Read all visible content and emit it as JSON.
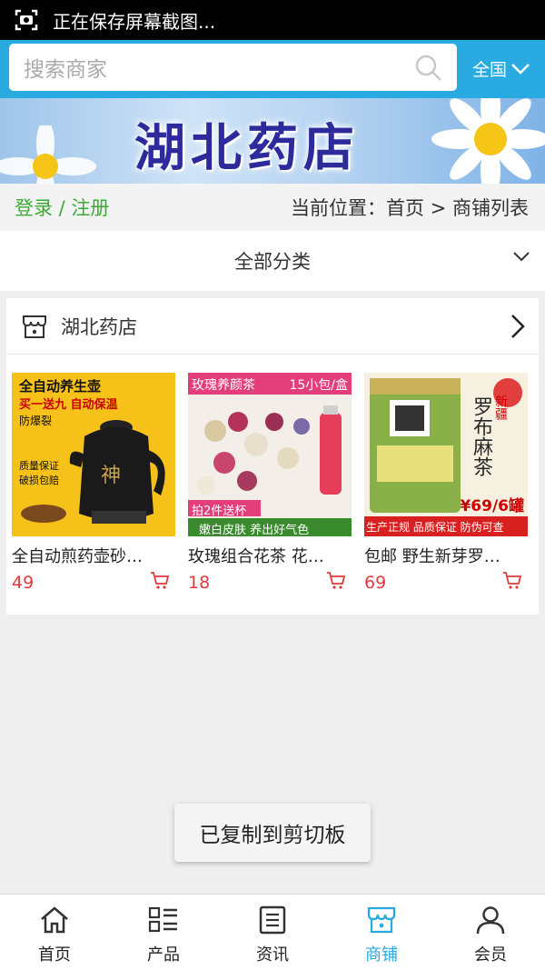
{
  "status_bar": {
    "text": "正在保存屏幕截图...",
    "icon": "screenshot-icon"
  },
  "search": {
    "placeholder": "搜索商家",
    "icon": "search-icon"
  },
  "region": {
    "label": "全国",
    "icon": "chevron-down-icon"
  },
  "banner": {
    "title": "湖北药店"
  },
  "breadcrumb": {
    "login_register": "登录 / 注册",
    "location": "当前位置：首页 > 商铺列表"
  },
  "category": {
    "label": "全部分类",
    "icon": "chevron-down-icon"
  },
  "store": {
    "name": "湖北药店",
    "icon": "shop-icon",
    "products": [
      {
        "name": "全自动煎药壶砂…",
        "price": "49",
        "thumb_lines": [
          "全自动养生壶",
          "买一送九 自动保温",
          "防爆裂",
          "质量保证",
          "破损包赔"
        ]
      },
      {
        "name": "玫瑰组合花茶 花…",
        "price": "18",
        "thumb_lines": [
          "玫瑰养颜茶",
          "15小包/盒",
          "拍2件送杯",
          "嫩白皮肤 养出好气色"
        ]
      },
      {
        "name": "包邮 野生新芽罗…",
        "price": "69",
        "thumb_lines": [
          "罗布麻茶",
          "新疆",
          "¥69/6罐",
          "生产正规 品质保证 防伪可查"
        ]
      }
    ]
  },
  "toast": {
    "text": "已复制到剪切板"
  },
  "tabbar": {
    "items": [
      {
        "label": "首页",
        "icon": "home-icon"
      },
      {
        "label": "产品",
        "icon": "grid-list-icon"
      },
      {
        "label": "资讯",
        "icon": "news-icon"
      },
      {
        "label": "商铺",
        "icon": "shop-icon",
        "active": true
      },
      {
        "label": "会员",
        "icon": "user-icon"
      }
    ]
  },
  "colors": {
    "header": "#29abe2",
    "login": "#3aaa35",
    "price": "#e4393c",
    "active_tab": "#29abe2"
  }
}
